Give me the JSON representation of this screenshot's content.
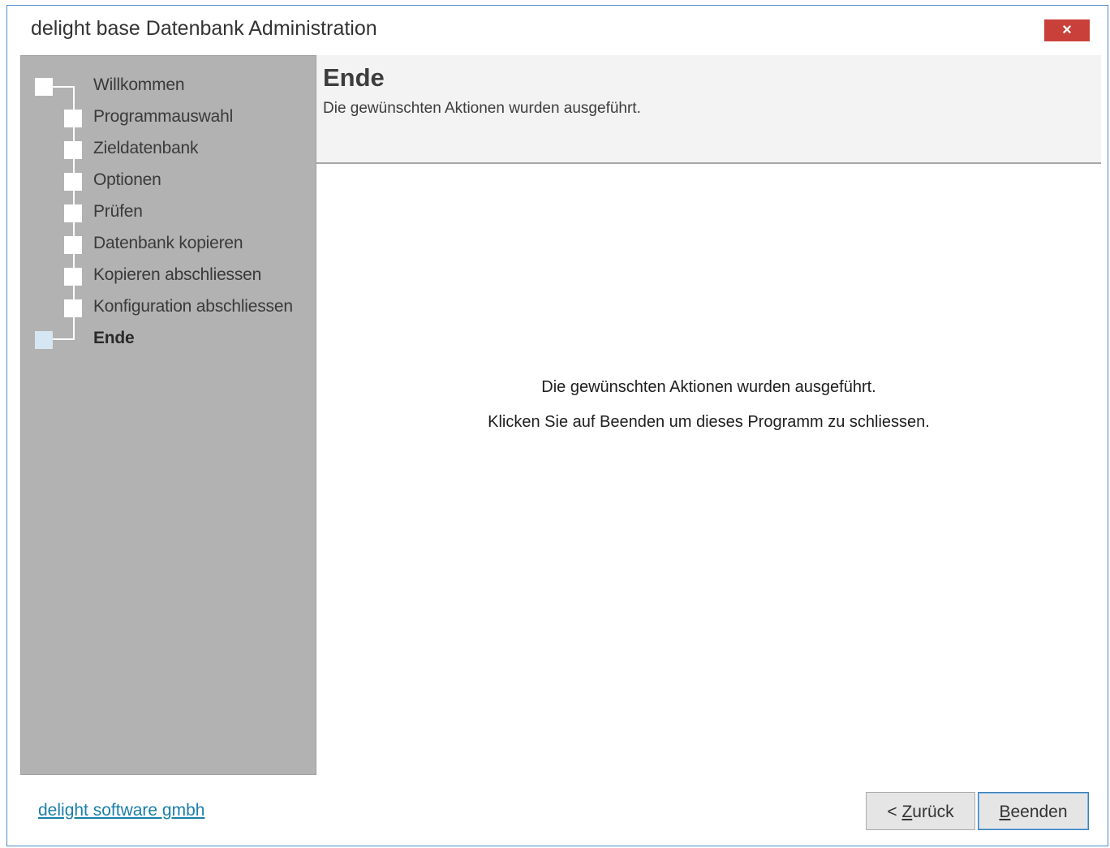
{
  "window": {
    "title": "delight base Datenbank Administration",
    "close_label": "×"
  },
  "steps": [
    {
      "label": "Willkommen",
      "status": "done"
    },
    {
      "label": "Programmauswahl",
      "status": "done"
    },
    {
      "label": "Zieldatenbank",
      "status": "done"
    },
    {
      "label": "Optionen",
      "status": "done"
    },
    {
      "label": "Prüfen",
      "status": "done"
    },
    {
      "label": "Datenbank kopieren",
      "status": "done"
    },
    {
      "label": "Kopieren abschliessen",
      "status": "done"
    },
    {
      "label": "Konfiguration abschliessen",
      "status": "done"
    },
    {
      "label": "Ende",
      "status": "current"
    }
  ],
  "header": {
    "title": "Ende",
    "subtitle": "Die gewünschten Aktionen wurden ausgeführt."
  },
  "content": {
    "line1": "Die gewünschten Aktionen wurden ausgeführt.",
    "line2": "Klicken Sie auf Beenden um dieses Programm zu schliessen."
  },
  "footer": {
    "company_link": "delight software gmbh",
    "back_button": {
      "prefix": "< ",
      "mnemonic": "Z",
      "rest": "urück"
    },
    "finish_button": {
      "mnemonic": "B",
      "rest": "eenden"
    }
  },
  "colors": {
    "close_button": "#c9403b",
    "sidebar_bg": "#b2b2b2",
    "link": "#1a7fa8",
    "active_step_marker": "#d6e6f3"
  }
}
